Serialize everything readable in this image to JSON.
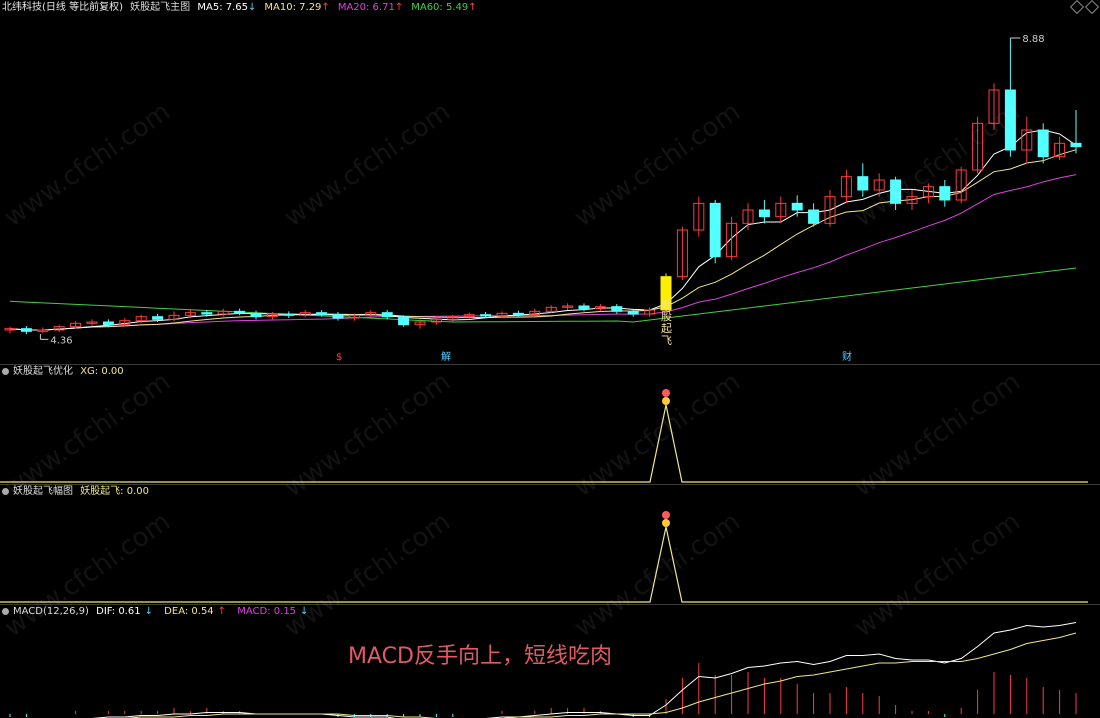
{
  "main_panel": {
    "stock_name": "北纬科技",
    "adjust_mode": "(日线 等比前复权)",
    "indicator": "妖股起飞主图",
    "ma": [
      {
        "label": "MA5: 7.65",
        "arrow": "↓",
        "color": "#ffffff",
        "arrow_color": "#4fd0ff"
      },
      {
        "label": "MA10: 7.29",
        "arrow": "↑",
        "color": "#f0e68c",
        "arrow_color": "#ff4040"
      },
      {
        "label": "MA20: 6.71",
        "arrow": "↑",
        "color": "#e040e0",
        "arrow_color": "#ff4040"
      },
      {
        "label": "MA60: 5.49",
        "arrow": "↑",
        "color": "#40d040",
        "arrow_color": "#ff4040"
      }
    ],
    "high_label": "8.88",
    "low_label": "4.36",
    "signal_text": "妖股起飞",
    "markers": [
      {
        "text": "$",
        "color": "#ff4040"
      },
      {
        "text": "解",
        "color": "#4fd0ff"
      },
      {
        "text": "财",
        "color": "#4fd0ff"
      }
    ]
  },
  "panel2": {
    "title": "妖股起飞优化",
    "value_label": "XG: 0.00"
  },
  "panel3": {
    "title": "妖股起飞幅图",
    "value_label": "妖股起飞: 0.00"
  },
  "macd_panel": {
    "title": "MACD(12,26,9)",
    "dif": "DIF: 0.61",
    "dif_arrow": "↓",
    "dea": "DEA: 0.54",
    "dea_arrow": "↑",
    "macd": "MACD: 0.15",
    "macd_arrow": "↓"
  },
  "caption": "MACD反手向上，短线吃肉",
  "watermark": "www.cfchi.com",
  "colors": {
    "up": "#ff3b3b",
    "down": "#54ffff",
    "signal_bar": "#ffee00",
    "ma5": "#ffffff",
    "ma10": "#f0e68c",
    "ma20": "#e040e0",
    "ma60": "#40d040"
  },
  "candles": [
    [
      4.5,
      4.52,
      4.55,
      4.45
    ],
    [
      4.52,
      4.48,
      4.56,
      4.44
    ],
    [
      4.48,
      4.5,
      4.54,
      4.45
    ],
    [
      4.5,
      4.55,
      4.58,
      4.47
    ],
    [
      4.55,
      4.6,
      4.63,
      4.52
    ],
    [
      4.6,
      4.62,
      4.66,
      4.55
    ],
    [
      4.62,
      4.58,
      4.66,
      4.54
    ],
    [
      4.58,
      4.64,
      4.68,
      4.55
    ],
    [
      4.64,
      4.7,
      4.73,
      4.6
    ],
    [
      4.7,
      4.66,
      4.74,
      4.62
    ],
    [
      4.66,
      4.72,
      4.78,
      4.63
    ],
    [
      4.72,
      4.76,
      4.8,
      4.68
    ],
    [
      4.76,
      4.74,
      4.8,
      4.7
    ],
    [
      4.74,
      4.78,
      4.82,
      4.7
    ],
    [
      4.78,
      4.75,
      4.82,
      4.72
    ],
    [
      4.75,
      4.7,
      4.79,
      4.66
    ],
    [
      4.7,
      4.74,
      4.77,
      4.66
    ],
    [
      4.74,
      4.72,
      4.78,
      4.68
    ],
    [
      4.72,
      4.76,
      4.8,
      4.69
    ],
    [
      4.76,
      4.73,
      4.8,
      4.7
    ],
    [
      4.73,
      4.68,
      4.77,
      4.64
    ],
    [
      4.68,
      4.72,
      4.75,
      4.64
    ],
    [
      4.72,
      4.76,
      4.8,
      4.68
    ],
    [
      4.76,
      4.7,
      4.8,
      4.66
    ],
    [
      4.7,
      4.58,
      4.72,
      4.55
    ],
    [
      4.58,
      4.62,
      4.66,
      4.52
    ],
    [
      4.62,
      4.66,
      4.7,
      4.58
    ],
    [
      4.66,
      4.7,
      4.73,
      4.62
    ],
    [
      4.7,
      4.73,
      4.76,
      4.66
    ],
    [
      4.73,
      4.71,
      4.77,
      4.68
    ],
    [
      4.71,
      4.75,
      4.78,
      4.68
    ],
    [
      4.75,
      4.73,
      4.79,
      4.7
    ],
    [
      4.73,
      4.78,
      4.82,
      4.71
    ],
    [
      4.78,
      4.84,
      4.87,
      4.75
    ],
    [
      4.84,
      4.86,
      4.9,
      4.8
    ],
    [
      4.86,
      4.82,
      4.9,
      4.78
    ],
    [
      4.82,
      4.85,
      4.89,
      4.78
    ],
    [
      4.85,
      4.78,
      4.89,
      4.74
    ],
    [
      4.78,
      4.74,
      4.82,
      4.7
    ],
    [
      4.74,
      4.8,
      4.84,
      4.7
    ],
    [
      4.8,
      5.3,
      5.35,
      4.78
    ],
    [
      5.3,
      6.0,
      6.05,
      5.25
    ],
    [
      6.0,
      6.4,
      6.5,
      5.9
    ],
    [
      6.4,
      5.6,
      6.45,
      5.5
    ],
    [
      5.6,
      6.1,
      6.2,
      5.55
    ],
    [
      6.1,
      6.3,
      6.4,
      6.0
    ],
    [
      6.3,
      6.2,
      6.45,
      6.1
    ],
    [
      6.2,
      6.4,
      6.5,
      6.1
    ],
    [
      6.4,
      6.3,
      6.52,
      6.2
    ],
    [
      6.3,
      6.1,
      6.4,
      6.05
    ],
    [
      6.1,
      6.5,
      6.6,
      6.05
    ],
    [
      6.5,
      6.8,
      6.9,
      6.4
    ],
    [
      6.8,
      6.6,
      7.0,
      6.5
    ],
    [
      6.6,
      6.75,
      6.85,
      6.5
    ],
    [
      6.75,
      6.4,
      6.8,
      6.3
    ],
    [
      6.4,
      6.5,
      6.6,
      6.3
    ],
    [
      6.5,
      6.65,
      6.7,
      6.4
    ],
    [
      6.65,
      6.45,
      6.75,
      6.35
    ],
    [
      6.45,
      6.9,
      6.95,
      6.4
    ],
    [
      6.9,
      7.6,
      7.7,
      6.85
    ],
    [
      7.6,
      8.1,
      8.2,
      7.5
    ],
    [
      8.1,
      7.2,
      8.88,
      7.1
    ],
    [
      7.2,
      7.5,
      7.7,
      7.0
    ],
    [
      7.5,
      7.1,
      7.6,
      7.0
    ],
    [
      7.1,
      7.3,
      7.4,
      7.05
    ],
    [
      7.3,
      7.25,
      7.8,
      7.15
    ]
  ],
  "macd_series": {
    "dif": [
      -0.05,
      -0.05,
      -0.04,
      -0.04,
      -0.03,
      -0.03,
      -0.02,
      -0.02,
      -0.01,
      -0.01,
      0.0,
      0.0,
      0.01,
      0.01,
      0.01,
      0.0,
      0.0,
      0.0,
      0.0,
      0.0,
      -0.01,
      -0.02,
      -0.02,
      -0.02,
      -0.04,
      -0.05,
      -0.05,
      -0.04,
      -0.03,
      -0.03,
      -0.02,
      -0.02,
      -0.01,
      0.0,
      0.01,
      0.01,
      0.01,
      0.0,
      -0.01,
      -0.01,
      0.06,
      0.16,
      0.25,
      0.24,
      0.27,
      0.31,
      0.32,
      0.34,
      0.35,
      0.33,
      0.35,
      0.39,
      0.39,
      0.4,
      0.37,
      0.36,
      0.36,
      0.34,
      0.37,
      0.45,
      0.54,
      0.56,
      0.59,
      0.58,
      0.59,
      0.61
    ],
    "dea": [
      -0.04,
      -0.04,
      -0.04,
      -0.04,
      -0.04,
      -0.03,
      -0.03,
      -0.03,
      -0.02,
      -0.02,
      -0.02,
      -0.01,
      -0.01,
      0.0,
      0.0,
      0.0,
      0.0,
      0.0,
      0.0,
      0.0,
      0.0,
      -0.01,
      -0.01,
      -0.01,
      -0.02,
      -0.02,
      -0.03,
      -0.03,
      -0.03,
      -0.03,
      -0.03,
      -0.02,
      -0.02,
      -0.02,
      -0.01,
      -0.01,
      0.0,
      0.0,
      0.0,
      0.0,
      0.01,
      0.04,
      0.08,
      0.11,
      0.14,
      0.17,
      0.2,
      0.22,
      0.25,
      0.26,
      0.28,
      0.3,
      0.32,
      0.34,
      0.34,
      0.35,
      0.35,
      0.35,
      0.35,
      0.37,
      0.4,
      0.43,
      0.47,
      0.49,
      0.51,
      0.54
    ]
  }
}
